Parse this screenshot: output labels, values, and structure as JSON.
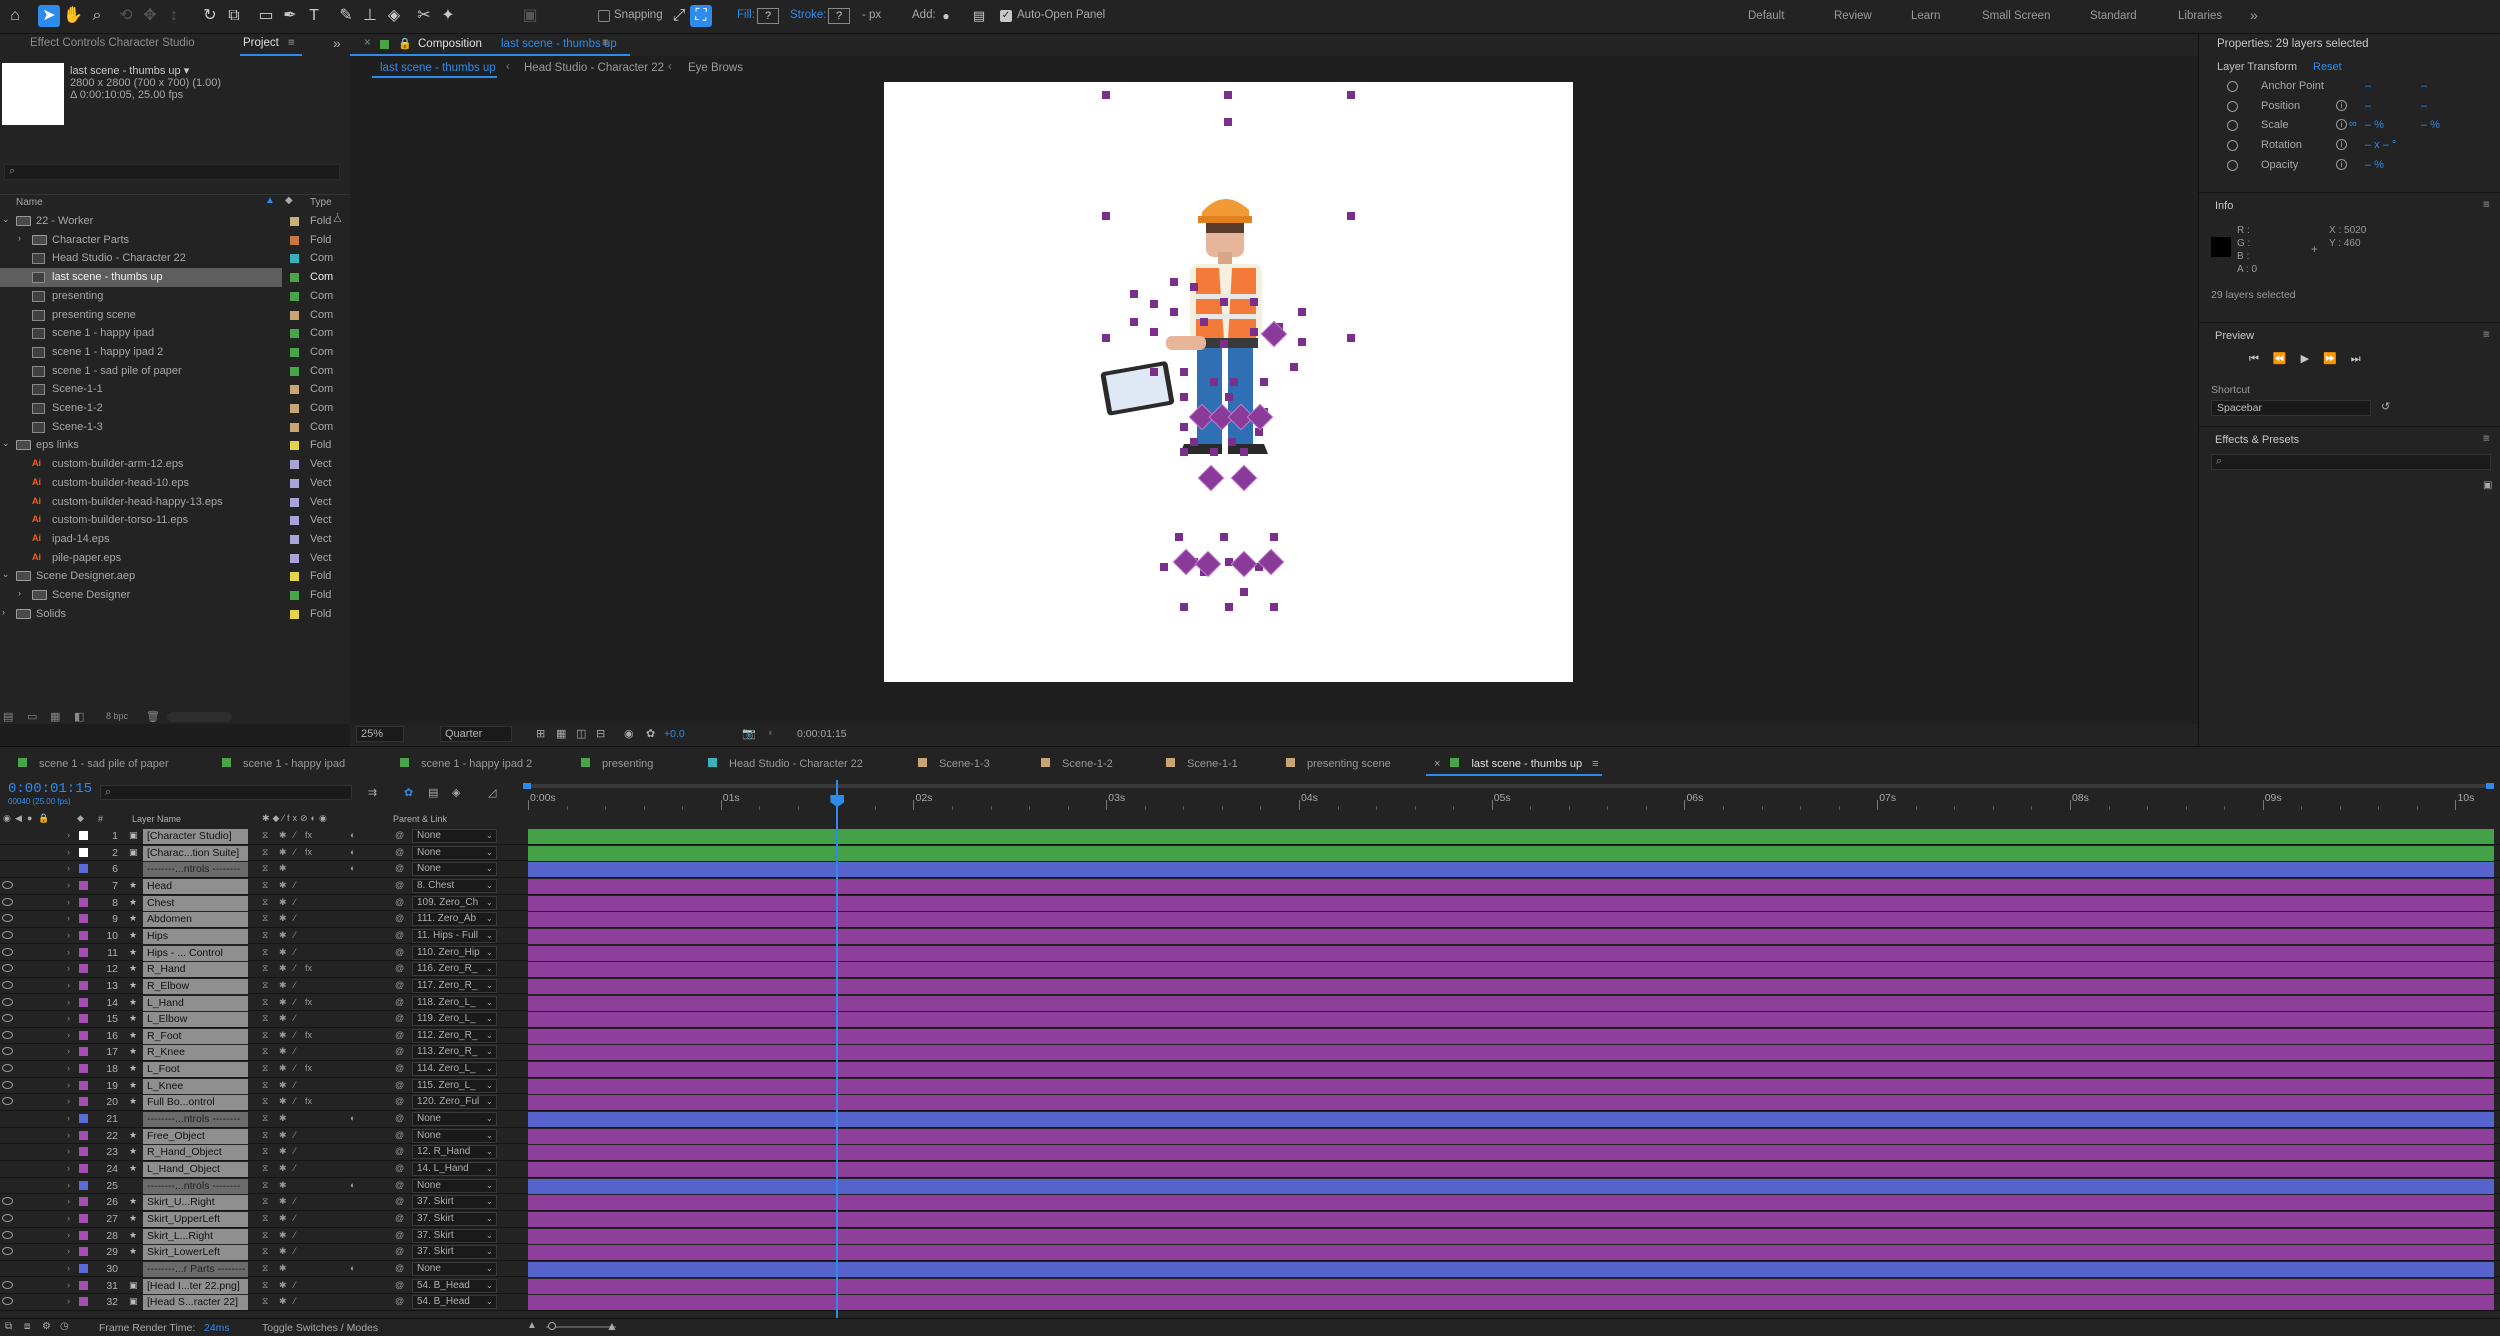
{
  "toolbar": {
    "snapping_label": "Snapping",
    "fill_label": "Fill:",
    "fill_value": "?",
    "stroke_label": "Stroke:",
    "stroke_value": "?",
    "stroke_px": "- px",
    "add_label": "Add:",
    "auto_open_label": "Auto-Open Panel",
    "workspaces": [
      "Default",
      "Review",
      "Learn",
      "Small Screen",
      "Standard",
      "Libraries"
    ],
    "more": "»"
  },
  "left_panel": {
    "tab_effect": "Effect Controls Character Studio",
    "tab_project": "Project",
    "selected_item": "last scene - thumbs up ▾",
    "item_info_1": "2800 x 2800 (700 x 700) (1.00)",
    "item_info_2": "Δ 0:00:10:05, 25.00 fps",
    "search_placeholder": "",
    "col_name": "Name",
    "col_type": "Type",
    "items": [
      {
        "name": "22 - Worker",
        "type": "Fold",
        "kind": "folder",
        "indent": 0,
        "open": true,
        "color": "#c8b273"
      },
      {
        "name": "Character Parts",
        "type": "Fold",
        "kind": "folder",
        "indent": 1,
        "open": false,
        "color": "#c8773e"
      },
      {
        "name": "Head Studio - Character 22",
        "type": "Com",
        "kind": "comp",
        "indent": 1,
        "color": "#3ab0b8"
      },
      {
        "name": "last scene - thumbs up",
        "type": "Com",
        "kind": "comp",
        "indent": 1,
        "color": "#49a547",
        "selected": true
      },
      {
        "name": "presenting",
        "type": "Com",
        "kind": "comp",
        "indent": 1,
        "color": "#49a547"
      },
      {
        "name": "presenting scene",
        "type": "Com",
        "kind": "comp",
        "indent": 1,
        "color": "#c8a673"
      },
      {
        "name": "scene 1 - happy ipad",
        "type": "Com",
        "kind": "comp",
        "indent": 1,
        "color": "#49a547"
      },
      {
        "name": "scene 1 - happy ipad 2",
        "type": "Com",
        "kind": "comp",
        "indent": 1,
        "color": "#49a547"
      },
      {
        "name": "scene 1 - sad pile of paper",
        "type": "Com",
        "kind": "comp",
        "indent": 1,
        "color": "#49a547"
      },
      {
        "name": "Scene-1-1",
        "type": "Com",
        "kind": "comp",
        "indent": 1,
        "color": "#c8a673"
      },
      {
        "name": "Scene-1-2",
        "type": "Com",
        "kind": "comp",
        "indent": 1,
        "color": "#c8a673"
      },
      {
        "name": "Scene-1-3",
        "type": "Com",
        "kind": "comp",
        "indent": 1,
        "color": "#c8a673"
      },
      {
        "name": "eps links",
        "type": "Fold",
        "kind": "folder",
        "indent": 0,
        "open": true,
        "color": "#e6d34a"
      },
      {
        "name": "custom-builder-arm-12.eps",
        "type": "Vect",
        "kind": "ai",
        "indent": 1,
        "color": "#a9a4d8"
      },
      {
        "name": "custom-builder-head-10.eps",
        "type": "Vect",
        "kind": "ai",
        "indent": 1,
        "color": "#a9a4d8"
      },
      {
        "name": "custom-builder-head-happy-13.eps",
        "type": "Vect",
        "kind": "ai",
        "indent": 1,
        "color": "#a9a4d8"
      },
      {
        "name": "custom-builder-torso-11.eps",
        "type": "Vect",
        "kind": "ai",
        "indent": 1,
        "color": "#a9a4d8"
      },
      {
        "name": "ipad-14.eps",
        "type": "Vect",
        "kind": "ai",
        "indent": 1,
        "color": "#a9a4d8"
      },
      {
        "name": "pile-paper.eps",
        "type": "Vect",
        "kind": "ai",
        "indent": 1,
        "color": "#a9a4d8"
      },
      {
        "name": "Scene Designer.aep",
        "type": "Fold",
        "kind": "folder",
        "indent": 0,
        "open": true,
        "color": "#e6d34a"
      },
      {
        "name": "Scene Designer",
        "type": "Fold",
        "kind": "folder",
        "indent": 1,
        "open": false,
        "color": "#49a547"
      },
      {
        "name": "Solids",
        "type": "Fold",
        "kind": "folder",
        "indent": 0,
        "open": false,
        "color": "#e6d34a"
      }
    ],
    "bpc": "8 bpc"
  },
  "composition": {
    "tab_prefix": "Composition",
    "tab_name": "last scene - thumbs up",
    "breadcrumbs": [
      "last scene - thumbs up",
      "Head Studio - Character 22",
      "Eye Brows"
    ],
    "zoom": "25%",
    "resolution": "Quarter",
    "exposure": "+0.0",
    "timecode": "0:00:01:15"
  },
  "right_panel": {
    "properties_title": "Properties: 29 layers selected",
    "layer_transform": "Layer Transform",
    "reset": "Reset",
    "props": [
      {
        "label": "Anchor Point",
        "v1": "–",
        "v2": "–"
      },
      {
        "label": "Position",
        "v1": "–",
        "v2": "–"
      },
      {
        "label": "Scale",
        "v1": "– %",
        "v2": "– %"
      },
      {
        "label": "Rotation",
        "v1": "– x – °",
        "v2": ""
      },
      {
        "label": "Opacity",
        "v1": "– %",
        "v2": ""
      }
    ],
    "info_title": "Info",
    "info_r": "R :",
    "info_g": "G :",
    "info_b": "B :",
    "info_a": "A : 0",
    "info_x": "X : 5020",
    "info_y": "Y : 460",
    "info_selected": "29 layers selected",
    "preview_title": "Preview",
    "shortcut_label": "Shortcut",
    "shortcut_value": "Spacebar",
    "effects_title": "Effects & Presets",
    "effects_placeholder": ""
  },
  "timeline": {
    "tabs": [
      {
        "name": "scene 1 - sad pile of paper",
        "color": "#49a547"
      },
      {
        "name": "scene 1 - happy ipad",
        "color": "#49a547"
      },
      {
        "name": "scene 1 - happy ipad 2",
        "color": "#49a547"
      },
      {
        "name": "presenting",
        "color": "#49a547"
      },
      {
        "name": "Head Studio - Character 22",
        "color": "#3ab0b8"
      },
      {
        "name": "Scene-1-3",
        "color": "#c8a673"
      },
      {
        "name": "Scene-1-2",
        "color": "#c8a673"
      },
      {
        "name": "Scene-1-1",
        "color": "#c8a673"
      },
      {
        "name": "presenting scene",
        "color": "#c8a673"
      },
      {
        "name": "last scene - thumbs up",
        "color": "#49a547",
        "active": true
      }
    ],
    "timecode": "0:00:01:15",
    "frame_info": "00040 (25.00 fps)",
    "col_layer_name": "Layer Name",
    "col_parent": "Parent & Link",
    "ruler": [
      "0:00s",
      "01s",
      "02s",
      "03s",
      "04s",
      "05s",
      "06s",
      "07s",
      "08s",
      "09s",
      "10s"
    ],
    "playhead_seconds": 1.6,
    "duration_seconds": 10.2,
    "layers": [
      {
        "num": "1",
        "name": "[Character Studio]",
        "parent": "None",
        "color": "#ffffff",
        "bar": "#44a148",
        "fx": true,
        "eye": false
      },
      {
        "num": "2",
        "name": "[Charac...tion Suite]",
        "parent": "None",
        "color": "#ffffff",
        "bar": "#44a148",
        "fx": true,
        "eye": false
      },
      {
        "num": "6",
        "name": "--------...ntrols --------",
        "parent": "None",
        "color": "#5a6ad8",
        "bar": "#5763cc",
        "sep": true,
        "eye": false
      },
      {
        "num": "7",
        "name": "Head",
        "parent": "8. Chest",
        "color": "#a44fb0",
        "bar": "#8e3f9b",
        "eye": true
      },
      {
        "num": "8",
        "name": "Chest",
        "parent": "109. Zero_Ch",
        "color": "#a44fb0",
        "bar": "#8e3f9b",
        "eye": true
      },
      {
        "num": "9",
        "name": "Abdomen",
        "parent": "111. Zero_Ab",
        "color": "#a44fb0",
        "bar": "#8e3f9b",
        "eye": true
      },
      {
        "num": "10",
        "name": "Hips",
        "parent": "11. Hips - Full",
        "color": "#a44fb0",
        "bar": "#8e3f9b",
        "eye": true
      },
      {
        "num": "11",
        "name": "Hips - ... Control",
        "parent": "110. Zero_Hip",
        "color": "#a44fb0",
        "bar": "#8e3f9b",
        "eye": true
      },
      {
        "num": "12",
        "name": "R_Hand",
        "parent": "116. Zero_R_",
        "color": "#a44fb0",
        "bar": "#8e3f9b",
        "fx": true,
        "eye": true
      },
      {
        "num": "13",
        "name": "R_Elbow",
        "parent": "117. Zero_R_",
        "color": "#a44fb0",
        "bar": "#8e3f9b",
        "eye": true
      },
      {
        "num": "14",
        "name": "L_Hand",
        "parent": "118. Zero_L_",
        "color": "#a44fb0",
        "bar": "#8e3f9b",
        "fx": true,
        "eye": true
      },
      {
        "num": "15",
        "name": "L_Elbow",
        "parent": "119. Zero_L_",
        "color": "#a44fb0",
        "bar": "#8e3f9b",
        "eye": true
      },
      {
        "num": "16",
        "name": "R_Foot",
        "parent": "112. Zero_R_",
        "color": "#a44fb0",
        "bar": "#8e3f9b",
        "fx": true,
        "eye": true
      },
      {
        "num": "17",
        "name": "R_Knee",
        "parent": "113. Zero_R_",
        "color": "#a44fb0",
        "bar": "#8e3f9b",
        "eye": true
      },
      {
        "num": "18",
        "name": "L_Foot",
        "parent": "114. Zero_L_",
        "color": "#a44fb0",
        "bar": "#8e3f9b",
        "fx": true,
        "eye": true
      },
      {
        "num": "19",
        "name": "L_Knee",
        "parent": "115. Zero_L_",
        "color": "#a44fb0",
        "bar": "#8e3f9b",
        "eye": true
      },
      {
        "num": "20",
        "name": "Full Bo...ontrol",
        "parent": "120. Zero_Ful",
        "color": "#a44fb0",
        "bar": "#8e3f9b",
        "fx": true,
        "eye": true
      },
      {
        "num": "21",
        "name": "--------...ntrols --------",
        "parent": "None",
        "color": "#5a6ad8",
        "bar": "#5763cc",
        "sep": true,
        "eye": false
      },
      {
        "num": "22",
        "name": "Free_Object",
        "parent": "None",
        "color": "#a44fb0",
        "bar": "#8e3f9b",
        "eye": false
      },
      {
        "num": "23",
        "name": "R_Hand_Object",
        "parent": "12. R_Hand",
        "color": "#a44fb0",
        "bar": "#8e3f9b",
        "eye": false
      },
      {
        "num": "24",
        "name": "L_Hand_Object",
        "parent": "14. L_Hand",
        "color": "#a44fb0",
        "bar": "#8e3f9b",
        "eye": false
      },
      {
        "num": "25",
        "name": "--------...ntrols --------",
        "parent": "None",
        "color": "#5a6ad8",
        "bar": "#5763cc",
        "sep": true,
        "eye": false
      },
      {
        "num": "26",
        "name": "Skirt_U...Right",
        "parent": "37. Skirt",
        "color": "#a44fb0",
        "bar": "#8e3f9b",
        "eye": true
      },
      {
        "num": "27",
        "name": "Skirt_UpperLeft",
        "parent": "37. Skirt",
        "color": "#a44fb0",
        "bar": "#8e3f9b",
        "eye": true
      },
      {
        "num": "28",
        "name": "Skirt_L...Right",
        "parent": "37. Skirt",
        "color": "#a44fb0",
        "bar": "#8e3f9b",
        "eye": true
      },
      {
        "num": "29",
        "name": "Skirt_LowerLeft",
        "parent": "37. Skirt",
        "color": "#a44fb0",
        "bar": "#8e3f9b",
        "eye": true
      },
      {
        "num": "30",
        "name": "--------...r Parts --------",
        "parent": "None",
        "color": "#5a6ad8",
        "bar": "#5763cc",
        "sep": true,
        "eye": false
      },
      {
        "num": "31",
        "name": "[Head I...ter 22.png]",
        "parent": "54. B_Head",
        "color": "#a44fb0",
        "bar": "#8e3f9b",
        "eye": true
      },
      {
        "num": "32",
        "name": "[Head S...racter 22]",
        "parent": "54. B_Head",
        "color": "#a44fb0",
        "bar": "#8e3f9b",
        "eye": true
      }
    ],
    "frame_render_label": "Frame Render Time:",
    "frame_render_value": "24ms",
    "toggle_label": "Toggle Switches / Modes"
  }
}
